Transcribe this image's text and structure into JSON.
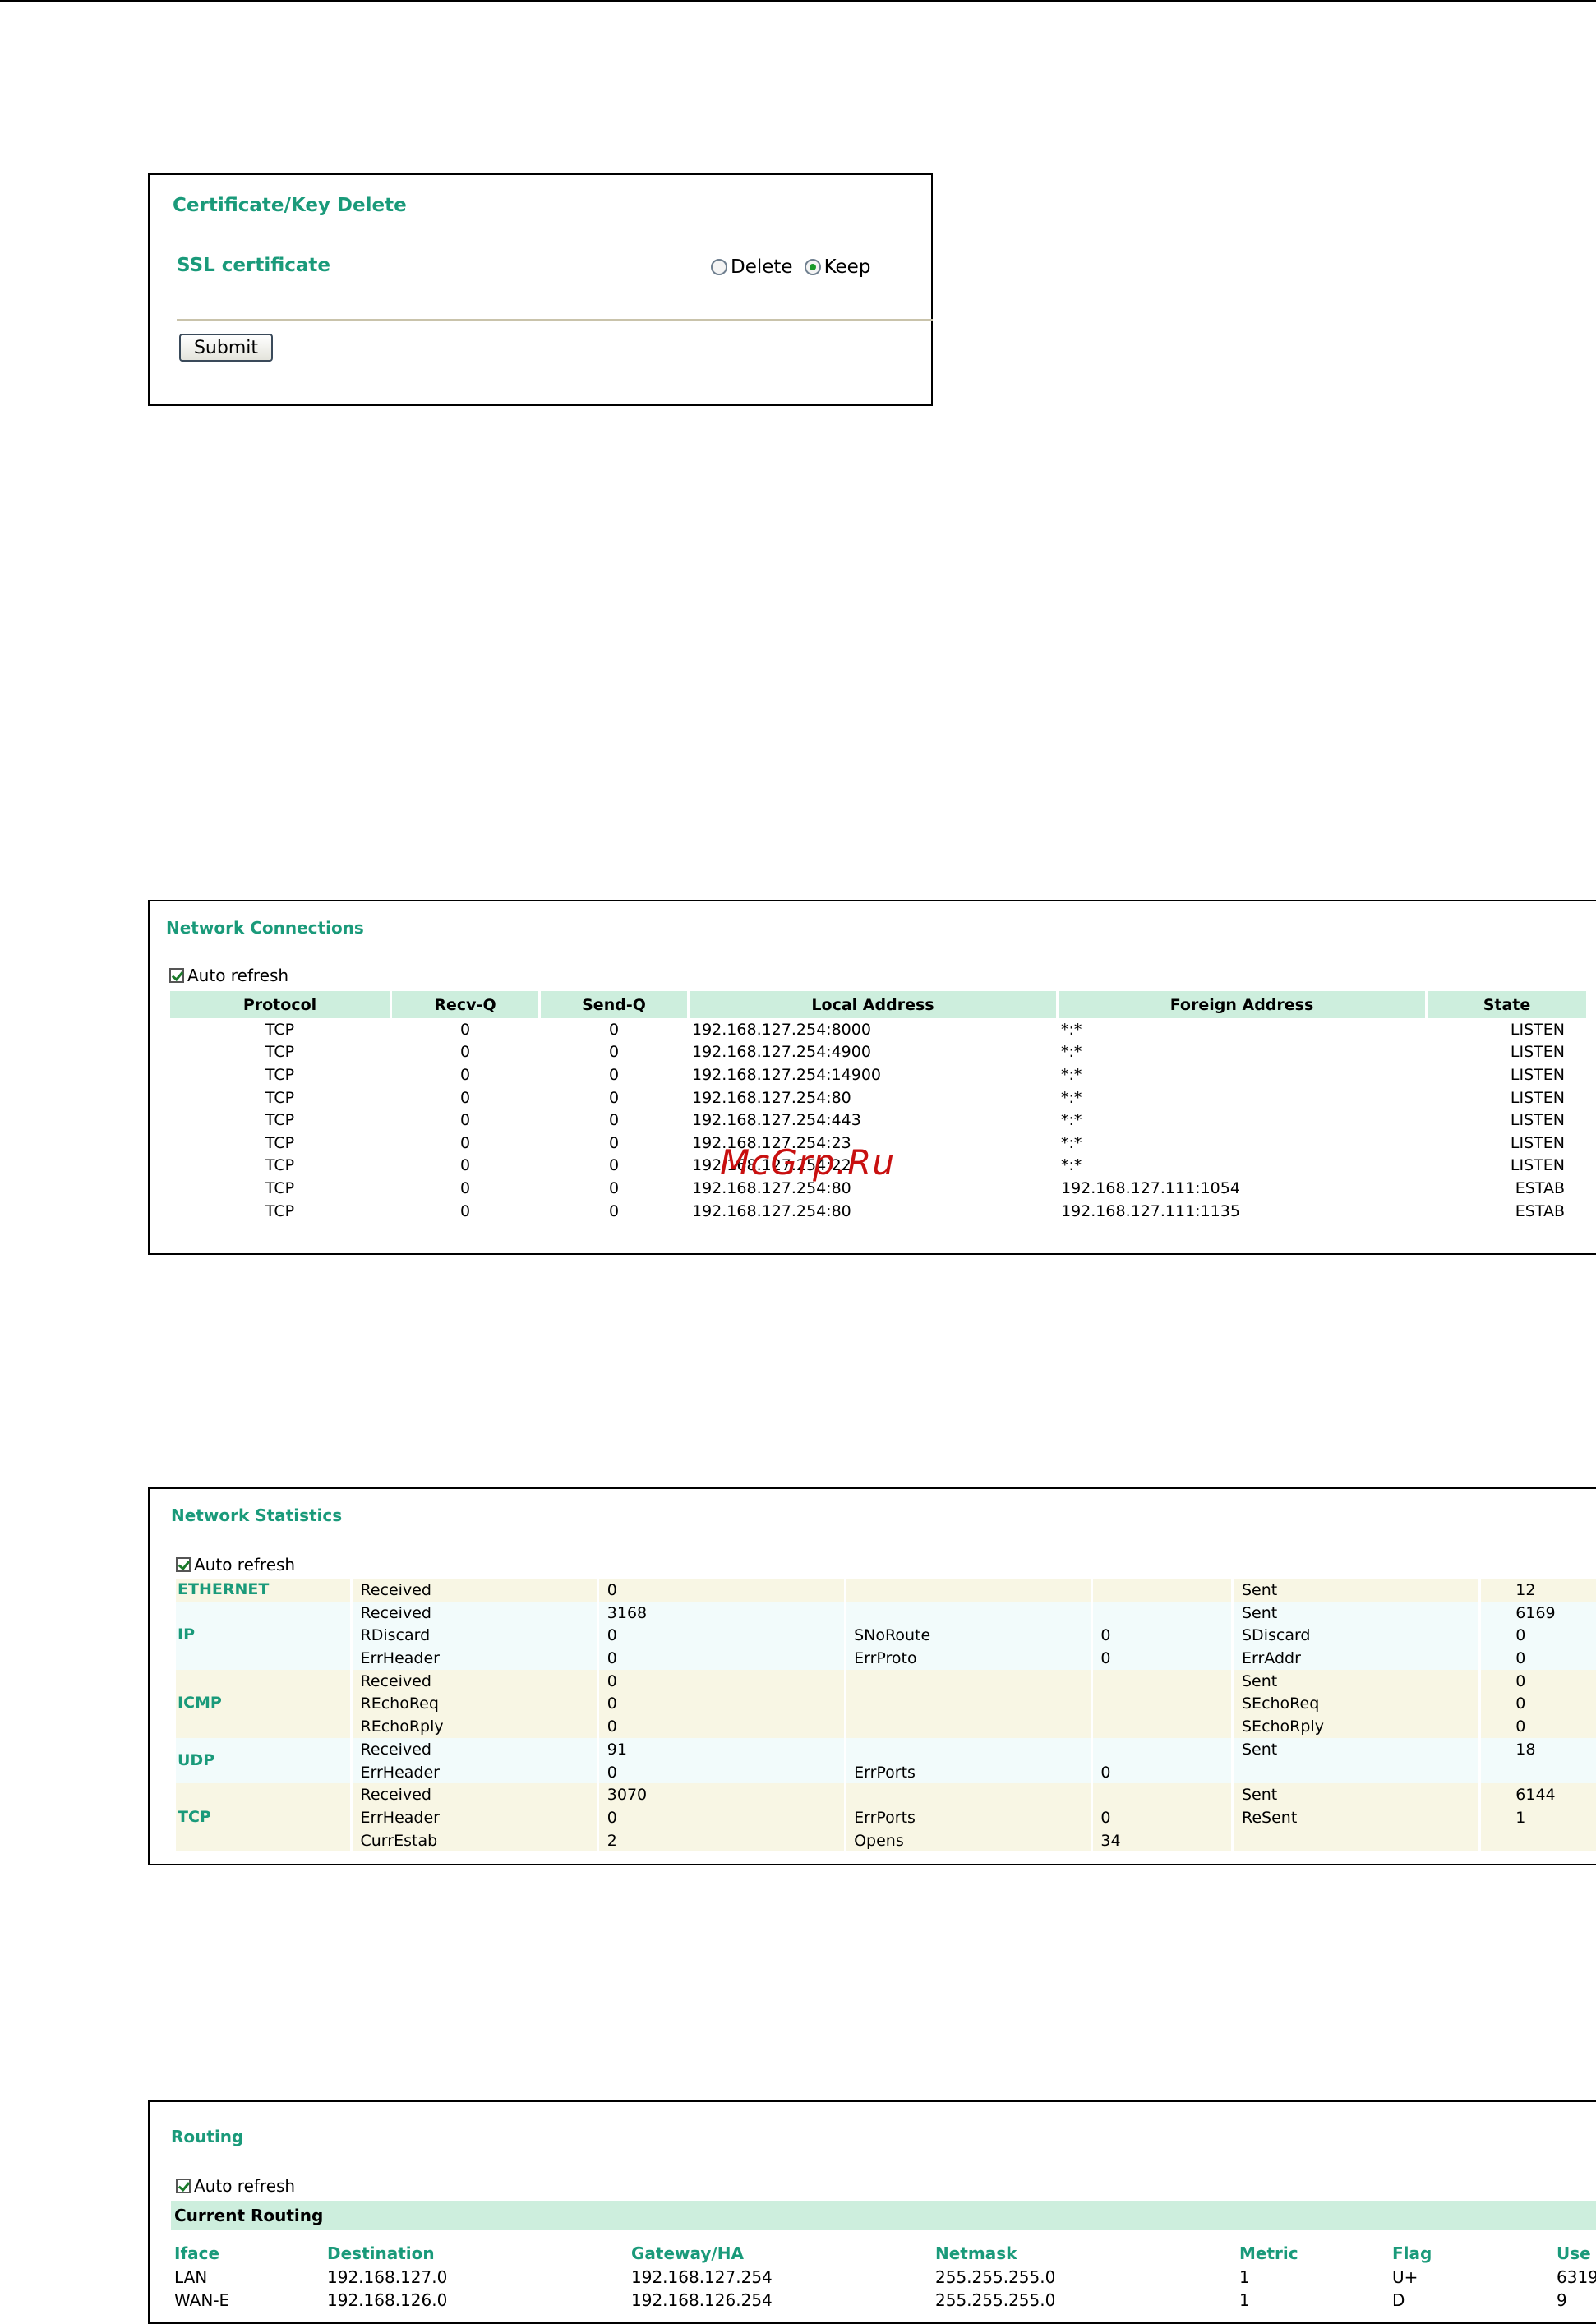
{
  "certificate": {
    "title": "Certificate/Key Delete",
    "label": "SSL certificate",
    "options": [
      {
        "label": "Delete",
        "selected": false
      },
      {
        "label": "Keep",
        "selected": true
      }
    ],
    "submit_label": "Submit"
  },
  "connections": {
    "title": "Network Connections",
    "auto_refresh_label": "Auto refresh",
    "auto_refresh_checked": true,
    "columns": [
      "Protocol",
      "Recv-Q",
      "Send-Q",
      "Local Address",
      "Foreign Address",
      "State"
    ],
    "rows": [
      [
        "TCP",
        "0",
        "0",
        "192.168.127.254:8000",
        "*:*",
        "LISTEN"
      ],
      [
        "TCP",
        "0",
        "0",
        "192.168.127.254:4900",
        "*:*",
        "LISTEN"
      ],
      [
        "TCP",
        "0",
        "0",
        "192.168.127.254:14900",
        "*:*",
        "LISTEN"
      ],
      [
        "TCP",
        "0",
        "0",
        "192.168.127.254:80",
        "*:*",
        "LISTEN"
      ],
      [
        "TCP",
        "0",
        "0",
        "192.168.127.254:443",
        "*:*",
        "LISTEN"
      ],
      [
        "TCP",
        "0",
        "0",
        "192.168.127.254:23",
        "*:*",
        "LISTEN"
      ],
      [
        "TCP",
        "0",
        "0",
        "192.168.127.254:22",
        "*:*",
        "LISTEN"
      ],
      [
        "TCP",
        "0",
        "0",
        "192.168.127.254:80",
        "192.168.127.111:1054",
        "ESTAB"
      ],
      [
        "TCP",
        "0",
        "0",
        "192.168.127.254:80",
        "192.168.127.111:1135",
        "ESTAB"
      ]
    ]
  },
  "statistics": {
    "title": "Network Statistics",
    "auto_refresh_label": "Auto refresh",
    "auto_refresh_checked": true,
    "groups": [
      {
        "name": "ETHERNET",
        "rows": [
          [
            "Received",
            "0",
            "",
            "",
            "Sent",
            "12"
          ]
        ]
      },
      {
        "name": "IP",
        "rows": [
          [
            "Received",
            "3168",
            "",
            "",
            "Sent",
            "6169"
          ],
          [
            "RDiscard",
            "0",
            "SNoRoute",
            "0",
            "SDiscard",
            "0"
          ],
          [
            "ErrHeader",
            "0",
            "ErrProto",
            "0",
            "ErrAddr",
            "0"
          ]
        ]
      },
      {
        "name": "ICMP",
        "rows": [
          [
            "Received",
            "0",
            "",
            "",
            "Sent",
            "0"
          ],
          [
            "REchoReq",
            "0",
            "",
            "",
            "SEchoReq",
            "0"
          ],
          [
            "REchoRply",
            "0",
            "",
            "",
            "SEchoRply",
            "0"
          ]
        ]
      },
      {
        "name": "UDP",
        "rows": [
          [
            "Received",
            "91",
            "",
            "",
            "Sent",
            "18"
          ],
          [
            "ErrHeader",
            "0",
            "ErrPorts",
            "0",
            "",
            ""
          ]
        ]
      },
      {
        "name": "TCP",
        "rows": [
          [
            "Received",
            "3070",
            "",
            "",
            "Sent",
            "6144"
          ],
          [
            "ErrHeader",
            "0",
            "ErrPorts",
            "0",
            "ReSent",
            "1"
          ],
          [
            "CurrEstab",
            "2",
            "Opens",
            "34",
            "",
            ""
          ]
        ]
      }
    ]
  },
  "routing": {
    "title": "Routing",
    "auto_refresh_label": "Auto refresh",
    "auto_refresh_checked": true,
    "section_label": "Current Routing",
    "columns": [
      "Iface",
      "Destination",
      "Gateway/HA",
      "Netmask",
      "Metric",
      "Flag",
      "Use"
    ],
    "rows": [
      [
        "LAN",
        "192.168.127.0",
        "192.168.127.254",
        "255.255.255.0",
        "1",
        "U+",
        "6319"
      ],
      [
        "WAN-E",
        "192.168.126.0",
        "192.168.126.254",
        "255.255.255.0",
        "1",
        "D",
        "9"
      ]
    ]
  },
  "watermark": "McGrp.Ru"
}
